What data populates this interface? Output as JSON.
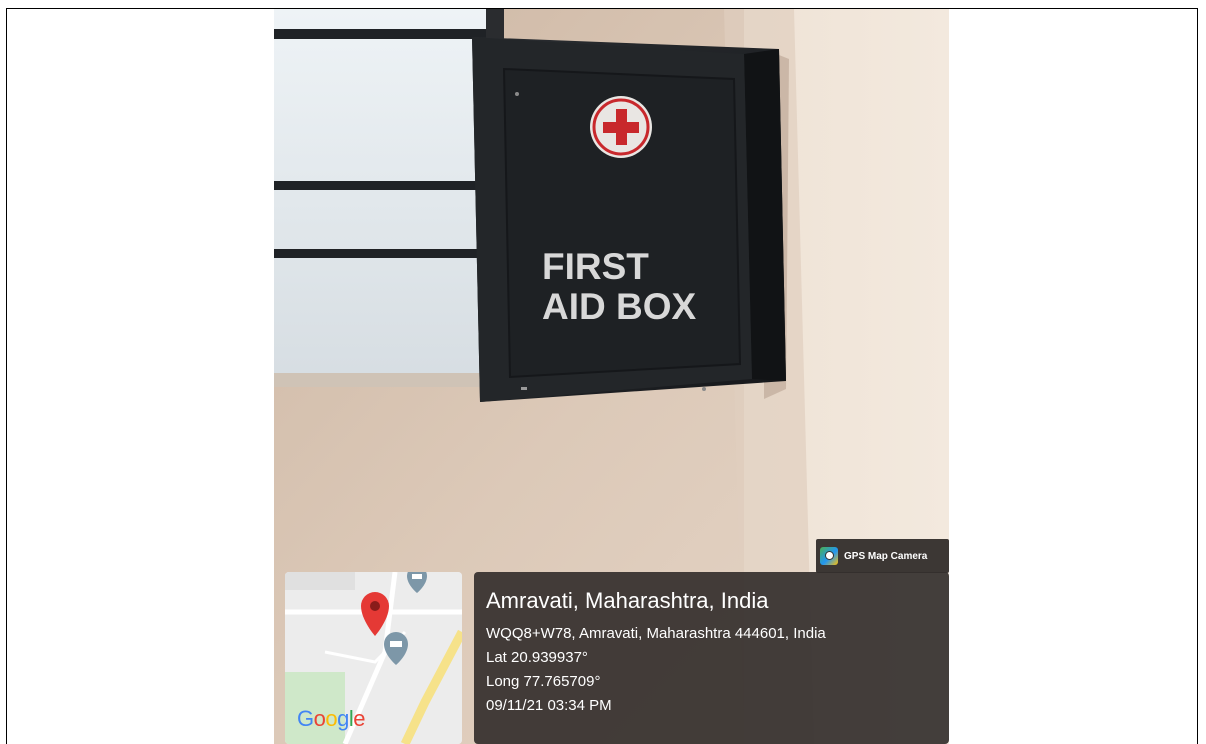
{
  "sign": {
    "line1": "FIRST",
    "line2": "AID BOX"
  },
  "overlay": {
    "app_name": "GPS Map Camera",
    "app_icon": "map-camera-icon",
    "location_title": "Amravati, Maharashtra, India",
    "address": "WQQ8+W78, Amravati, Maharashtra 444601, India",
    "latitude": "Lat 20.939937°",
    "longitude": "Long 77.765709°",
    "datetime": "09/11/21 03:34 PM",
    "map_logo": "Google"
  },
  "colors": {
    "box": "#1f2226",
    "wall": "#d8c6b6",
    "cross": "#c8282c",
    "pin": "#e53935",
    "panel": "#342f2c"
  }
}
